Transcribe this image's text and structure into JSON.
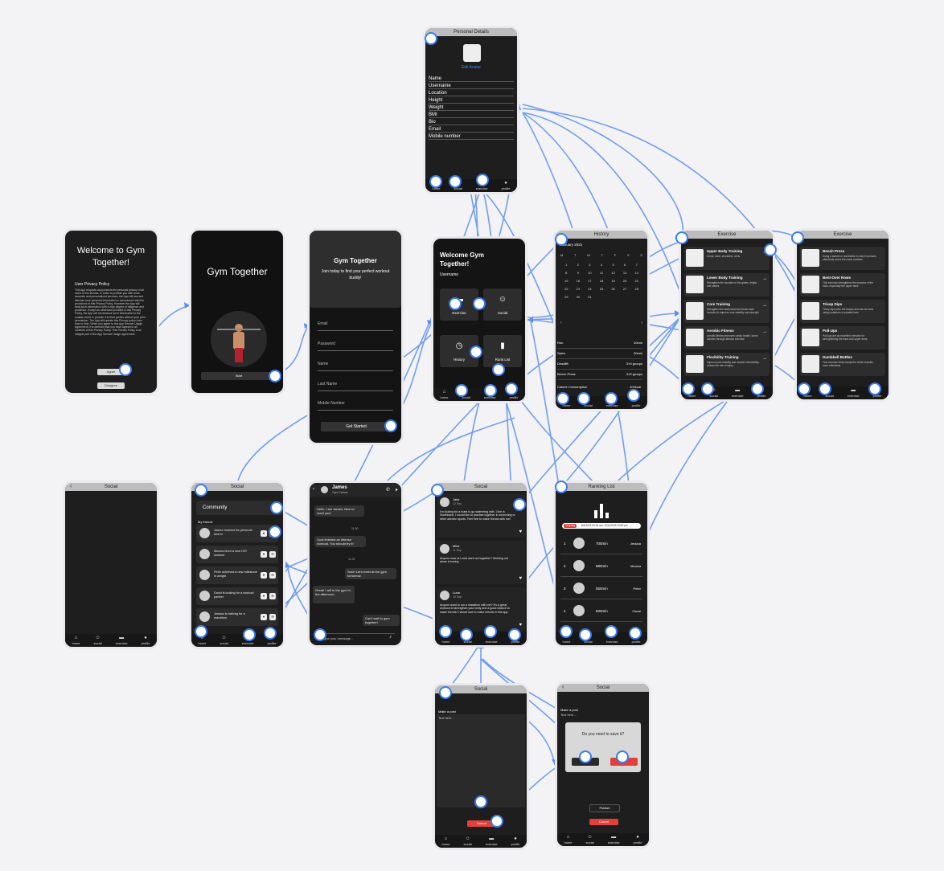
{
  "nav": {
    "home": "home",
    "social": "social",
    "exercise": "exercise",
    "profile": "profile"
  },
  "welcome": {
    "title": "Welcome to Gym Together!",
    "policy_title": "User Privacy Policy",
    "policy_text": "This App respects and protects the personal privacy of all users of the service. In order to provide you with more accurate and personalized services, the App will use and disclose your personal information in accordance with the provisions of this Privacy Policy. However the App will treat such information with a high degree of diligence and prudence. Except as otherwise provided in this Privacy Policy, the App will not disclose such information to the outside world or provide it to third parties without your prior permission. The App will update this Privacy policy from time to time. When you agree to this App Service Usage Agreement, it is deemed that you have agreed to all contents of this Privacy Policy. This Privacy Policy is an integral part of the App Service Usage Agreement.",
    "agree": "Agree",
    "disagree": "Disagree"
  },
  "splash": {
    "title": "Gym Together",
    "start": "Start"
  },
  "register": {
    "title": "Gym Together",
    "subtitle": "Join today to find your perfect workout buddy!",
    "fields": [
      "Email",
      "Password",
      "Name",
      "Last Name",
      "Mobile Number"
    ],
    "submit": "Get Started"
  },
  "personal": {
    "header": "Personal Details",
    "edit_avatar": "Edit Avatar",
    "fields": [
      "Name",
      "Username",
      "Location",
      "Height",
      "Weight",
      "BMI",
      "Bio",
      "Email",
      "Mobile number"
    ]
  },
  "home": {
    "title": "Welcome Gym Together!",
    "username": "Username",
    "tiles": [
      "Exercise",
      "Social",
      "History",
      "Rank List"
    ]
  },
  "history": {
    "header": "History",
    "month": "January 2021",
    "weekdays": [
      "M",
      "T",
      "W",
      "T",
      "F",
      "S",
      "S"
    ],
    "days": [
      "1",
      "2",
      "3",
      "4",
      "5",
      "6",
      "7",
      "8",
      "9",
      "10",
      "11",
      "12",
      "13",
      "14",
      "15",
      "16",
      "17",
      "18",
      "19",
      "20",
      "21",
      "22",
      "23",
      "24",
      "25",
      "26",
      "27",
      "28",
      "29",
      "30",
      "31"
    ],
    "stats": [
      {
        "label": "Run",
        "value": "40min"
      },
      {
        "label": "Swim",
        "value": "30min"
      },
      {
        "label": "Deadlift",
        "value": "3×5 groups"
      },
      {
        "label": "Bench Press",
        "value": "3×5 groups"
      }
    ],
    "calorie_label": "Calorie Consumption",
    "calorie_value": "400kcal"
  },
  "exercise1": {
    "header": "Exercise",
    "items": [
      {
        "title": "Upper Body Training",
        "desc": "Chest, back, shoulders, arms"
      },
      {
        "title": "Lower Body Training",
        "desc": "Strengthen the muscles of the glutes, thighs and calves"
      },
      {
        "title": "Core Training",
        "desc": "Strengthen the abdominal and lower back muscles to improve core stability and strength"
      },
      {
        "title": "Aerobic Fitness",
        "desc": "Aerobic fitness improves cardio health, burns calories through aerobic exercise"
      },
      {
        "title": "Flexibility Training",
        "desc": "Improve joint mobility and muscle extensibility, reduce the risk of injury"
      }
    ]
  },
  "exercise2": {
    "header": "Exercise",
    "items": [
      {
        "title": "Bench Press",
        "desc": "Using a barbell or dumbbells for bench presses effectively works the chest muscles"
      },
      {
        "title": "Bent-Over Rows",
        "desc": "This exercise strengthens the muscles of the back, especially the upper back"
      },
      {
        "title": "Tricep Dips",
        "desc": "Tricep dips work the triceps and can be done using a platform or parallel bars"
      },
      {
        "title": "Pull-Ups",
        "desc": "Pull-ups are an excellent exercise for strengthening the back and upper arms"
      },
      {
        "title": "Dumbbell Bottles",
        "desc": "This exercise helps sculpt the chest muscles more effectively"
      }
    ]
  },
  "social_empty": {
    "header": "Social"
  },
  "social_friends": {
    "header": "Social",
    "community": "Community",
    "my_friends": "My friends",
    "friends": [
      "James reached his personal best in",
      "Monica hired a new HIIT workout",
      "Peter achieved a new milestone in weight",
      "David is looking for a workout partner",
      "Jessica is training for a marathon"
    ]
  },
  "chat": {
    "name": "James",
    "role": "Gym Partner",
    "messages": [
      "Hello, I am James. Nice to meet you!",
      "I just finished an intense workout. You should try it!",
      "Sure! Let's meet at the gym tomorrow.",
      "Great! I will in the gym in the afternoon.",
      "Can't wait to gym together!"
    ],
    "times": [
      "11:00",
      "11:00"
    ],
    "placeholder": "Type your message..."
  },
  "social_posts": {
    "header": "Social",
    "posts": [
      {
        "name": "Jake",
        "date": "12 Sep",
        "text": "I'm looking for a mate to go swimming with. I live in Southbank. I would like to practise together in swimming or other aerobic sports. Feel free to make friends with me!"
      },
      {
        "name": "Mike",
        "date": "11 Sep",
        "text": "Anyone near at Lucia work out together? Working out alone is boring."
      },
      {
        "name": "Luna",
        "date": "10 Sep",
        "text": "Anyone want to run a marathon with me? It's a great workout to strengthen your body and a good chance to make friends! I would love to make friends in this app."
      }
    ]
  },
  "ranking": {
    "header": "Ranking List",
    "tab_badge": "Ongoing",
    "period": "8/4/2023 00:00 am - 8/11/2023 23:59 pm",
    "rows": [
      {
        "rank": "1",
        "value": "700min",
        "name": "Jessica"
      },
      {
        "rank": "2",
        "value": "680min",
        "name": "Monica"
      },
      {
        "rank": "3",
        "value": "550min",
        "name": "Peter"
      },
      {
        "rank": "4",
        "value": "500min",
        "name": "Oscar"
      }
    ]
  },
  "post_new": {
    "header": "Social",
    "make_post": "Make a post",
    "placeholder": "Text here...",
    "cancel": "Cancel"
  },
  "post_confirm": {
    "header": "Social",
    "make_post": "Make a post",
    "placeholder": "Text here...",
    "dialog": "Do you need to save it?",
    "publish": "Publish",
    "cancel": "Cancel"
  }
}
